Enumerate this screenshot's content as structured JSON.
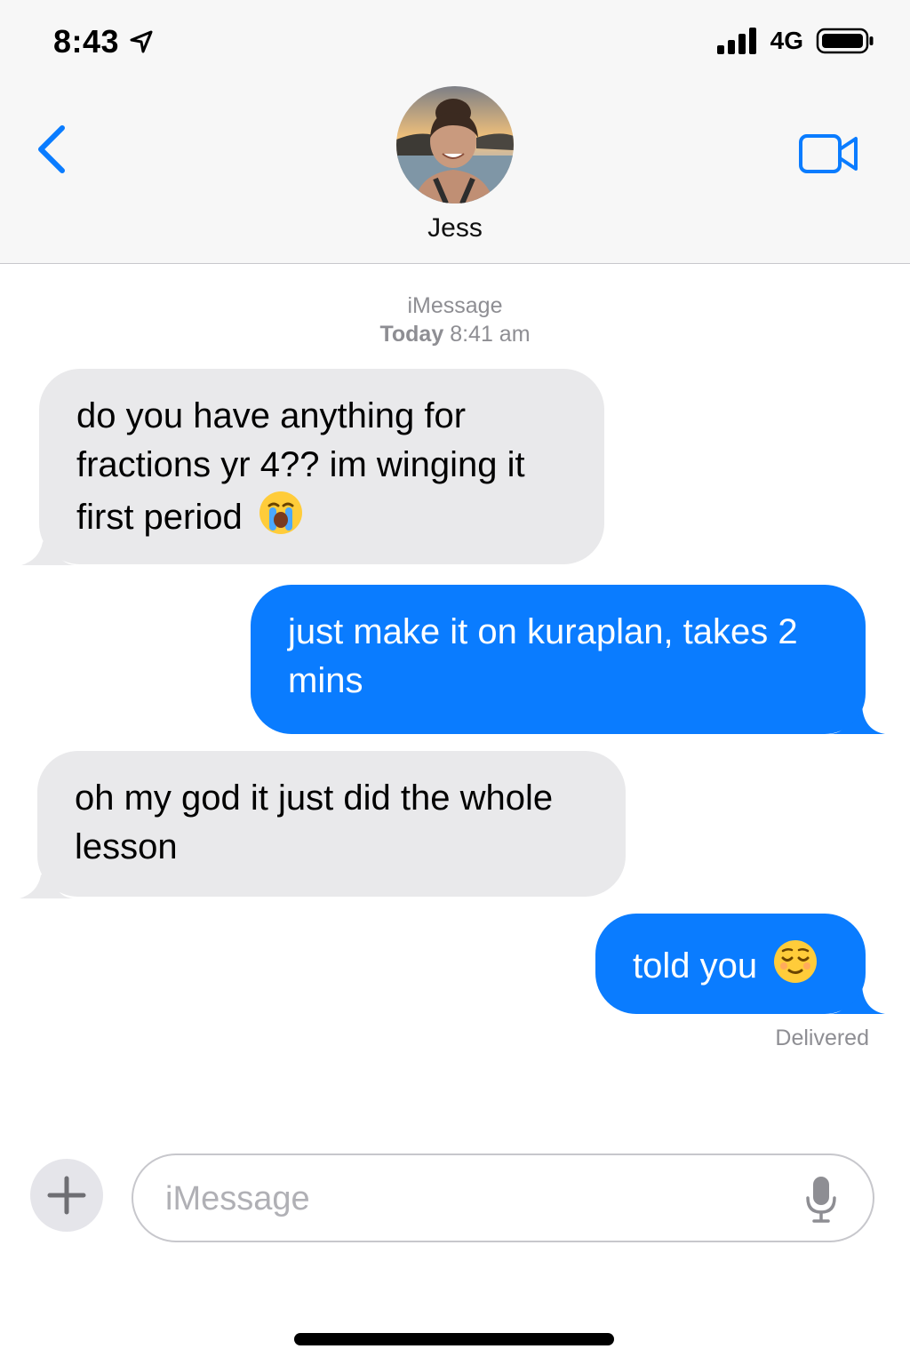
{
  "status_bar": {
    "time": "8:43",
    "network": "4G"
  },
  "header": {
    "contact_name": "Jess"
  },
  "conversation": {
    "service": "iMessage",
    "day": "Today",
    "time": "8:41 am",
    "messages": [
      {
        "direction": "incoming",
        "text": "do you have anything for fractions yr 4?? im winging it first period",
        "emoji": "loudly-crying-face"
      },
      {
        "direction": "outgoing",
        "text": "just make it on kuraplan, takes 2 mins"
      },
      {
        "direction": "incoming",
        "text": "oh my god it just did the whole lesson"
      },
      {
        "direction": "outgoing",
        "text": "told you",
        "emoji": "relieved-face"
      }
    ],
    "receipt": "Delivered"
  },
  "composer": {
    "placeholder": "iMessage"
  },
  "colors": {
    "outgoing_bubble": "#0a7cff",
    "incoming_bubble": "#e9e9eb",
    "accent": "#0a7cff",
    "meta_text": "#8e8e93"
  }
}
